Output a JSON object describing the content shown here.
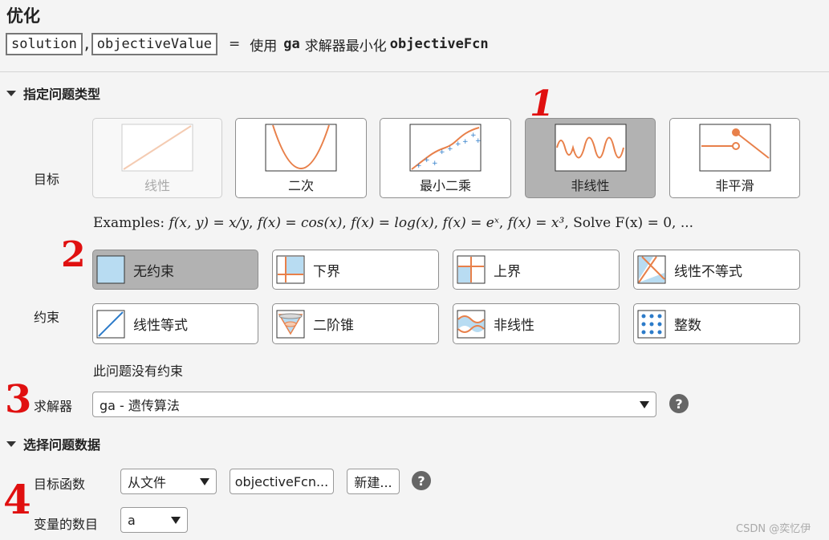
{
  "header": {
    "title": "优化",
    "output1": "solution",
    "comma": ",",
    "output2": "objectiveValue",
    "eq": "=",
    "use_text": "使用",
    "solver_name": "ga",
    "minimize_text": "求解器最小化",
    "func_name": "objectiveFcn"
  },
  "section1": {
    "title": "指定问题类型",
    "objective_label": "目标",
    "objective_types": [
      {
        "label": "线性",
        "state": "disabled"
      },
      {
        "label": "二次",
        "state": "normal"
      },
      {
        "label": "最小二乘",
        "state": "normal"
      },
      {
        "label": "非线性",
        "state": "selected"
      },
      {
        "label": "非平滑",
        "state": "normal"
      }
    ],
    "examples": {
      "prefix": "Examples: ",
      "items": [
        "f(x, y) = x/y",
        "f(x) = cos(x)",
        "f(x) = log(x)",
        "f(x) = eˣ",
        "f(x) = x³"
      ],
      "suffix": "Solve F(x) = 0, ..."
    },
    "constraints_label": "约束",
    "constraints": [
      {
        "label": "无约束",
        "icon": "unconstrained-icon",
        "state": "selected"
      },
      {
        "label": "下界",
        "icon": "lower-bound-icon",
        "state": "normal"
      },
      {
        "label": "上界",
        "icon": "upper-bound-icon",
        "state": "normal"
      },
      {
        "label": "线性不等式",
        "icon": "linear-inequality-icon",
        "state": "normal"
      },
      {
        "label": "线性等式",
        "icon": "linear-equality-icon",
        "state": "normal"
      },
      {
        "label": "二阶锥",
        "icon": "second-order-cone-icon",
        "state": "normal"
      },
      {
        "label": "非线性",
        "icon": "nonlinear-constraint-icon",
        "state": "normal"
      },
      {
        "label": "整数",
        "icon": "integer-icon",
        "state": "normal"
      }
    ],
    "constraint_note": "此问题没有约束",
    "solver_label": "求解器",
    "solver_value": "ga - 遗传算法"
  },
  "section2": {
    "title": "选择问题数据",
    "objfun_label": "目标函数",
    "objfun_source": "从文件",
    "objfun_file": "objectiveFcn...",
    "new_button": "新建...",
    "numvars_label": "变量的数目",
    "numvars_value": "a"
  },
  "annotations": [
    "1",
    "2",
    "3",
    "4"
  ],
  "watermark": "CSDN @奕忆伊",
  "colors": {
    "accent": "#e8804a",
    "blue": "#2c7bc9",
    "selected": "#b2b2b2",
    "red": "#e01010"
  }
}
